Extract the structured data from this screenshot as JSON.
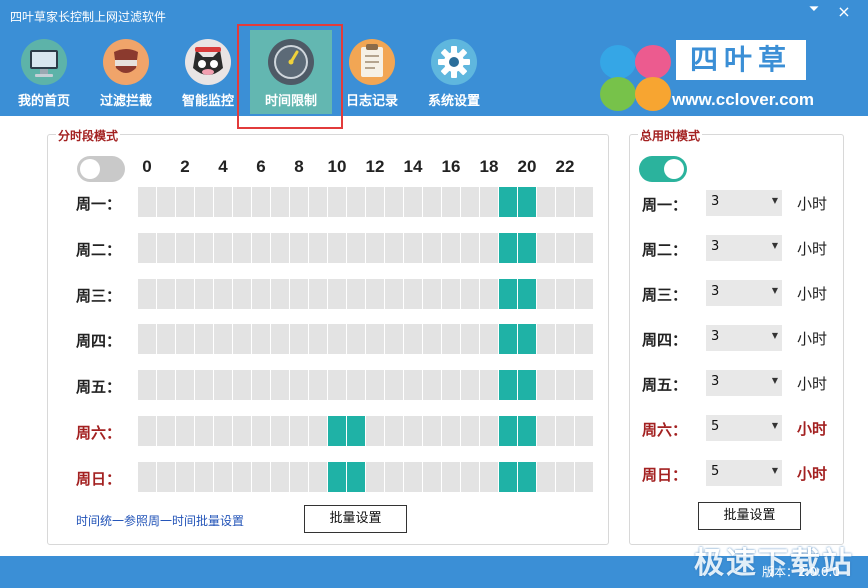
{
  "window": {
    "title": "四叶草家长控制上网过滤软件",
    "minimize_icon": "minimize-icon",
    "close_icon": "close-icon",
    "minimize_glyph": "⏷",
    "close_glyph": "×"
  },
  "nav": [
    {
      "label": "我的首页",
      "icon": "monitor-icon",
      "active": false
    },
    {
      "label": "过滤拦截",
      "icon": "shield-icon",
      "active": false
    },
    {
      "label": "智能监控",
      "icon": "cat-face-icon",
      "active": false
    },
    {
      "label": "时间限制",
      "icon": "stopwatch-icon",
      "active": true
    },
    {
      "label": "日志记录",
      "icon": "clipboard-icon",
      "active": false
    },
    {
      "label": "系统设置",
      "icon": "gear-icon",
      "active": false
    }
  ],
  "brand": {
    "logo_text": "四叶草",
    "url": "www.cclover.com",
    "colors": {
      "pink": "#ec5b8f",
      "green": "#77c24a",
      "blue": "#35a6e6",
      "orange": "#f7a531"
    }
  },
  "slot_mode": {
    "title": "分时段模式",
    "enabled": false,
    "hours": [
      "0",
      "2",
      "4",
      "6",
      "8",
      "10",
      "12",
      "14",
      "16",
      "18",
      "20",
      "22"
    ],
    "days": [
      {
        "label": "周一：",
        "weekend": false,
        "on": [
          19,
          20
        ]
      },
      {
        "label": "周二：",
        "weekend": false,
        "on": [
          19,
          20
        ]
      },
      {
        "label": "周三：",
        "weekend": false,
        "on": [
          19,
          20
        ]
      },
      {
        "label": "周四：",
        "weekend": false,
        "on": [
          19,
          20
        ]
      },
      {
        "label": "周五：",
        "weekend": false,
        "on": [
          19,
          20
        ]
      },
      {
        "label": "周六：",
        "weekend": true,
        "on": [
          10,
          11,
          19,
          20
        ]
      },
      {
        "label": "周日：",
        "weekend": true,
        "on": [
          10,
          11,
          19,
          20
        ]
      }
    ],
    "batch_note": "时间统一参照周一时间批量设置",
    "batch_button": "批量设置"
  },
  "total_mode": {
    "title": "总用时模式",
    "enabled": true,
    "unit": "小时",
    "days": [
      {
        "label": "周一：",
        "value": "3",
        "weekend": false
      },
      {
        "label": "周二：",
        "value": "3",
        "weekend": false
      },
      {
        "label": "周三：",
        "value": "3",
        "weekend": false
      },
      {
        "label": "周四：",
        "value": "3",
        "weekend": false
      },
      {
        "label": "周五：",
        "value": "3",
        "weekend": false
      },
      {
        "label": "周六：",
        "value": "5",
        "weekend": true
      },
      {
        "label": "周日：",
        "value": "5",
        "weekend": true
      }
    ],
    "batch_button": "批量设置"
  },
  "footer": {
    "watermark": "极速下载站",
    "version": "版本：2.0.0.0"
  },
  "colors": {
    "header_blue": "#3b8fd6",
    "active_tab": "#63b7b1",
    "highlight_border": "#e23b3b",
    "cell_on": "#1fb2a6",
    "cell_off": "#e3e3e3",
    "weekend_text": "#a32121"
  }
}
